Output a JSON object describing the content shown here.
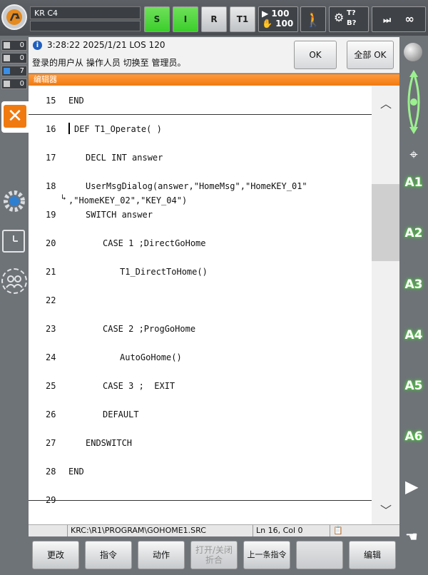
{
  "topbar": {
    "controller_name": "KR C4",
    "status_buttons": [
      {
        "label": "S",
        "state": "green"
      },
      {
        "label": "I",
        "state": "green"
      },
      {
        "label": "R",
        "state": "grey"
      },
      {
        "label": "T1",
        "state": "grey"
      }
    ],
    "override_program": "100",
    "override_jog": "100",
    "tool_base_t": "T?",
    "tool_base_b": "B?",
    "increment": "∞"
  },
  "left_counters": [
    "0",
    "0",
    "7",
    "0"
  ],
  "message": {
    "time_line": "3:28:22 2025/1/21 LOS 120",
    "text": "登录的用户从 操作人员 切换至 管理员。",
    "ok_label": "OK",
    "all_ok_label": "全部 OK"
  },
  "editor": {
    "title": "编辑器",
    "lines": [
      {
        "num": "15",
        "code": "END",
        "indent": 0
      },
      {
        "num": "16",
        "code": "DEF T1_Operate( )",
        "indent": 1
      },
      {
        "num": "17",
        "code": "DECL INT answer",
        "indent": 2
      },
      {
        "num": "18",
        "code": "UserMsgDialog(answer,\"HomeMsg\",\"HomeKEY_01\"",
        "cont": ",\"HomeKEY_02\",\"KEY_04\")",
        "indent": 2
      },
      {
        "num": "19",
        "code": "SWITCH answer",
        "indent": 2
      },
      {
        "num": "20",
        "code": "CASE 1 ;DirectGoHome",
        "indent": 3
      },
      {
        "num": "21",
        "code": "T1_DirectToHome()",
        "indent": 4
      },
      {
        "num": "22",
        "code": "",
        "indent": 0
      },
      {
        "num": "23",
        "code": "CASE 2 ;ProgGoHome",
        "indent": 3
      },
      {
        "num": "24",
        "code": "AutoGoHome()",
        "indent": 4
      },
      {
        "num": "25",
        "code": "CASE 3 ;  EXIT",
        "indent": 3
      },
      {
        "num": "26",
        "code": "DEFAULT",
        "indent": 3
      },
      {
        "num": "27",
        "code": "ENDSWITCH",
        "indent": 2
      },
      {
        "num": "28",
        "code": "END",
        "indent": 0
      },
      {
        "num": "29",
        "code": "",
        "indent": 0
      }
    ]
  },
  "statusbar": {
    "path": "KRC:\\R1\\PROGRAM\\GOHOME1.SRC",
    "position": "Ln 16, Col 0"
  },
  "softkeys": {
    "change": "更改",
    "command": "指令",
    "action": "动作",
    "fold_line1": "打开/关闭",
    "fold_line2": "折合",
    "last_command": "上一条指令",
    "empty": "",
    "edit": "编辑"
  },
  "right_axes": [
    "A1",
    "A2",
    "A3",
    "A4",
    "A5",
    "A6"
  ]
}
